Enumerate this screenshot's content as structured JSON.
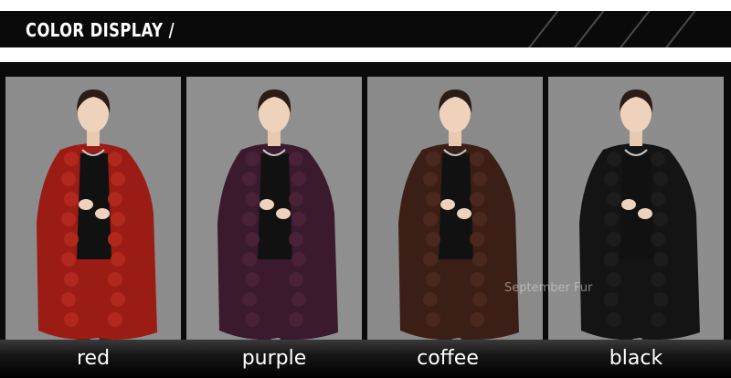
{
  "header": {
    "title": "COLOR DISPLAY /"
  },
  "watermark": "September Fur",
  "products": [
    {
      "label": "red",
      "garment_color": "#9b1c14",
      "trim_color": "#b0281e",
      "bg": "#8c8c8c"
    },
    {
      "label": "purple",
      "garment_color": "#3a1a2c",
      "trim_color": "#4a2238",
      "bg": "#8f8f8f"
    },
    {
      "label": "coffee",
      "garment_color": "#3b1f16",
      "trim_color": "#4a281d",
      "bg": "#8a8a8a"
    },
    {
      "label": "black",
      "garment_color": "#141414",
      "trim_color": "#1c1c1c",
      "bg": "#8d8d8d"
    }
  ]
}
